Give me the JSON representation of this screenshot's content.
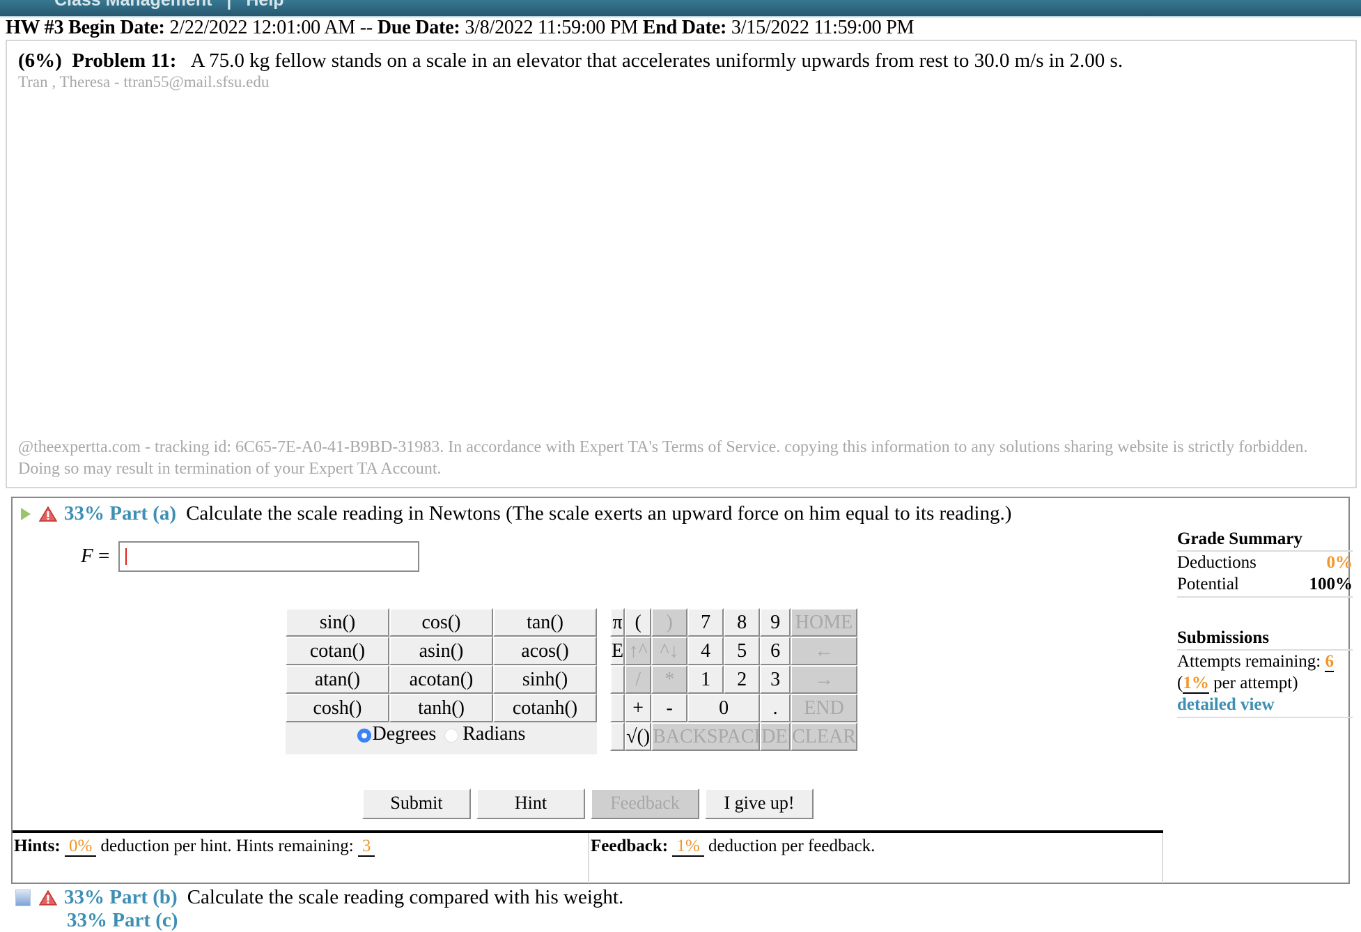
{
  "topbar": {
    "items": [
      "Class Management",
      "|",
      "Help"
    ]
  },
  "assignment": {
    "hw_label": "HW #3",
    "begin_label": "Begin Date:",
    "begin_value": "2/22/2022 12:01:00 AM",
    "separator": "--",
    "due_label": "Due Date:",
    "due_value": "3/8/2022 11:59:00 PM",
    "end_label": "End Date:",
    "end_value": "3/15/2022 11:59:00 PM"
  },
  "problem": {
    "weight": "(6%)",
    "label": "Problem 11:",
    "text": "A 75.0 kg fellow stands on a scale in an elevator that accelerates uniformly upwards from rest to 30.0 m/s in 2.00 s.",
    "student": "Tran , Theresa  - ttran55@mail.sfsu.edu",
    "watermark": "@theexpertta.com - tracking id: 6C65-7E-A0-41-B9BD-31983. In accordance with Expert TA's Terms of Service. copying this information to any solutions sharing website is strictly forbidden. Doing so may result in termination of your Expert TA Account."
  },
  "part_a": {
    "percent": "33% Part (a)",
    "question": "Calculate the scale reading in Newtons (The scale exerts an upward force on him equal to its reading.)",
    "variable": "F",
    "equals": "=",
    "answer_value": ""
  },
  "keypad": {
    "functions": [
      [
        "sin()",
        "cos()",
        "tan()"
      ],
      [
        "cotan()",
        "asin()",
        "acos()"
      ],
      [
        "atan()",
        "acotan()",
        "sinh()"
      ],
      [
        "cosh()",
        "tanh()",
        "cotanh()"
      ]
    ],
    "angle_modes": {
      "degrees": "Degrees",
      "radians": "Radians",
      "selected": "Degrees"
    },
    "keys": {
      "pi": "π",
      "lparen": "(",
      "rparen": ")",
      "k7": "7",
      "k8": "8",
      "k9": "9",
      "home": "HOME",
      "e": "E",
      "up": "↑^",
      "down": "^↓",
      "k4": "4",
      "k5": "5",
      "k6": "6",
      "left": "←",
      "div": "/",
      "mul": "*",
      "k1": "1",
      "k2": "2",
      "k3": "3",
      "right": "→",
      "plus": "+",
      "minus": "-",
      "k0": "0",
      "dot": ".",
      "end": "END",
      "sqrt": "√()",
      "backspace": "BACKSPACE",
      "del": "DEL",
      "clear": "CLEAR"
    }
  },
  "actions": {
    "submit": "Submit",
    "hint": "Hint",
    "feedback": "Feedback",
    "give_up": "I give up!"
  },
  "hints": {
    "label": "Hints:",
    "deduction": "0%",
    "text": "deduction per hint. Hints remaining:",
    "remaining": "3"
  },
  "feedback": {
    "label": "Feedback:",
    "deduction": "1%",
    "text": "deduction per feedback."
  },
  "grade_summary": {
    "title": "Grade Summary",
    "deductions_label": "Deductions",
    "deductions_value": "0%",
    "potential_label": "Potential",
    "potential_value": "100%"
  },
  "submissions": {
    "title": "Submissions",
    "attempts_label": "Attempts remaining:",
    "attempts_value": "6",
    "per_attempt_value": "1%",
    "per_attempt_text": "per attempt)",
    "detailed_view": "detailed view"
  },
  "part_b": {
    "percent": "33% Part (b)",
    "question": "Calculate the scale reading compared with his weight."
  },
  "part_c": {
    "percent": "33% Part (c)"
  },
  "colors": {
    "accent": "#3e8fb3",
    "orange": "#f0962a",
    "topbar": "#2f6a82"
  }
}
